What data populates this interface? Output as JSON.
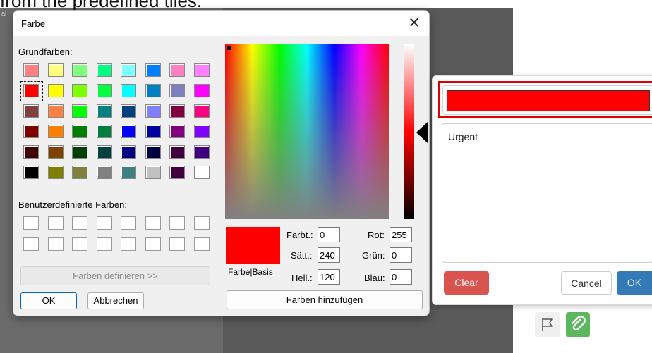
{
  "background": {
    "top_text": "from the predefined tiles.",
    "corner_label": "al"
  },
  "dialog": {
    "title": "Farbe",
    "close_glyph": "✕",
    "basic_colors_label": "Grundfarben:",
    "custom_colors_label": "Benutzerdefinierte Farben:",
    "define_button": "Farben definieren >>",
    "ok_button": "OK",
    "cancel_button": "Abbrechen",
    "add_button": "Farben hinzufügen",
    "preview_label": "Farbe|Basis",
    "basic_colors": [
      "#ff8080",
      "#ffff80",
      "#80ff80",
      "#00ff80",
      "#80ffff",
      "#0080ff",
      "#ff80c0",
      "#ff80ff",
      "#ff0000",
      "#ffff00",
      "#80ff00",
      "#00ff40",
      "#00ffff",
      "#0080c0",
      "#8080c0",
      "#ff00ff",
      "#804040",
      "#ff8040",
      "#00ff00",
      "#008080",
      "#004080",
      "#8080ff",
      "#800040",
      "#ff0080",
      "#800000",
      "#ff8000",
      "#008000",
      "#008040",
      "#0000ff",
      "#0000a0",
      "#800080",
      "#8000ff",
      "#400000",
      "#804000",
      "#004000",
      "#004040",
      "#000080",
      "#000040",
      "#400040",
      "#400080",
      "#000000",
      "#808000",
      "#808040",
      "#808080",
      "#408080",
      "#c0c0c0",
      "#400040",
      "#ffffff"
    ],
    "selected_index": 8,
    "fields": {
      "hue_label": "Farbt.:",
      "hue": "0",
      "sat_label": "Sätt.:",
      "sat": "240",
      "lum_label": "Hell.:",
      "lum": "120",
      "red_label": "Rot:",
      "red": "255",
      "green_label": "Grün:",
      "green": "0",
      "blue_label": "Blau:",
      "blue": "0"
    },
    "current_color": "#ff0000"
  },
  "popup": {
    "color_value": "#ff0000",
    "note_text": "Urgent",
    "clear_button": "Clear",
    "cancel_button": "Cancel",
    "ok_button": "OK"
  },
  "toolbar": {
    "flag_icon": "flag-icon",
    "attach_icon": "paperclip-icon"
  }
}
